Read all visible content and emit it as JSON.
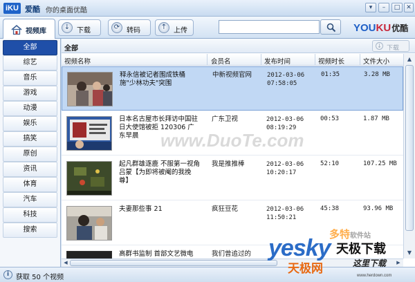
{
  "window": {
    "logo": "iKU",
    "app_name": "爱酷",
    "subtitle": "你的桌面优酷"
  },
  "toolbar": {
    "home_tab": "视频库",
    "download": "下载",
    "transcode": "转码",
    "upload": "上传",
    "search_placeholder": "",
    "brand_a": "YOU",
    "brand_b": "KU",
    "brand_c": "优酷"
  },
  "sidebar": {
    "items": [
      "全部",
      "综艺",
      "音乐",
      "游戏",
      "动漫",
      "娱乐",
      "搞笑",
      "原创",
      "资讯",
      "体育",
      "汽车",
      "科技",
      "搜索"
    ]
  },
  "main": {
    "title": "全部",
    "download_all": "下载",
    "columns": [
      "视频名称",
      "会员名",
      "发布时间",
      "视频时长",
      "文件大小"
    ],
    "rows": [
      {
        "title": "释永信被记者围成铁桶 施\"少林功夫\"突围",
        "member": "中新视频官网",
        "date": "2012-03-06",
        "time": "07:58:05",
        "duration": "01:35",
        "size": "3.28 MB"
      },
      {
        "title": "日本名古屋市长拜访中国驻日大使馆被拒 120306 广东早晨",
        "member": "广东卫视",
        "date": "2012-03-06",
        "time": "08:19:29",
        "duration": "00:53",
        "size": "1.87 MB"
      },
      {
        "title": "起凡群雄逐鹿 不服第一视角吕蒙【为即将被阉的我挽尊】",
        "member": "我是推推棒",
        "date": "2012-03-06",
        "time": "10:20:17",
        "duration": "52:10",
        "size": "107.25 MB"
      },
      {
        "title": "夫妻那些事 21",
        "member": "疯狂豆花",
        "date": "2012-03-06",
        "time": "11:50:21",
        "duration": "45:38",
        "size": "93.96 MB"
      },
      {
        "title": "高群书监制 首部文艺微电",
        "member": "我们曾追过的",
        "date": "",
        "time": "",
        "duration": "",
        "size": ""
      }
    ]
  },
  "status": {
    "text": "获取 50 个视频"
  },
  "watermarks": {
    "duote": "www.DuoTe.com",
    "duote_cn": "多特",
    "duote_cn2": "软件站",
    "yesky": "yesky",
    "yesky_cn": "天极下载",
    "tianji": "天极网",
    "zheli": "这里下载",
    "url": "www.herdown.com"
  },
  "colors": {
    "accent": "#1f4fa8",
    "selection": "#c1d8f4",
    "brand_blue": "#1e5fc6",
    "brand_red": "#c8283b"
  }
}
